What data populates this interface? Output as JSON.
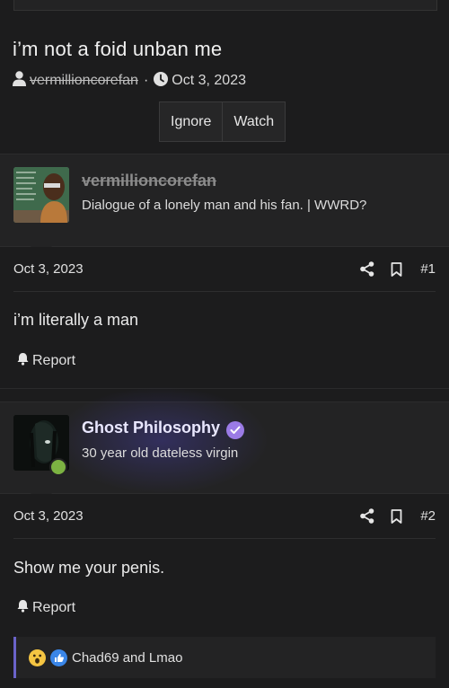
{
  "thread": {
    "title": "i’m not a foid unban me",
    "author": "vermillioncorefan",
    "separator": "·",
    "date": "Oct 3, 2023",
    "buttons": {
      "ignore": "Ignore",
      "watch": "Watch"
    }
  },
  "posts": [
    {
      "username": "vermillioncorefan",
      "user_title": "Dialogue of a lonely man and his fan. | WWRD?",
      "date": "Oct 3, 2023",
      "post_number": "#1",
      "body": "i’m literally a man",
      "report_label": "Report"
    },
    {
      "username": "Ghost Philosophy",
      "user_title": "30 year old dateless virgin",
      "date": "Oct 3, 2023",
      "post_number": "#2",
      "body": "Show me your penis.",
      "report_label": "Report",
      "reactions_text": "Chad69 and Lmao"
    }
  ],
  "icons": [
    "user-icon",
    "clock-icon",
    "share-icon",
    "bookmark-icon",
    "bell-icon",
    "verified-badge-icon",
    "wow-reaction-icon",
    "like-reaction-icon"
  ],
  "colors": {
    "background": "#1c1c1d",
    "accent": "#6a63c9",
    "verified": "#9b7be6",
    "online": "#7cb342",
    "like": "#3a86e8"
  }
}
